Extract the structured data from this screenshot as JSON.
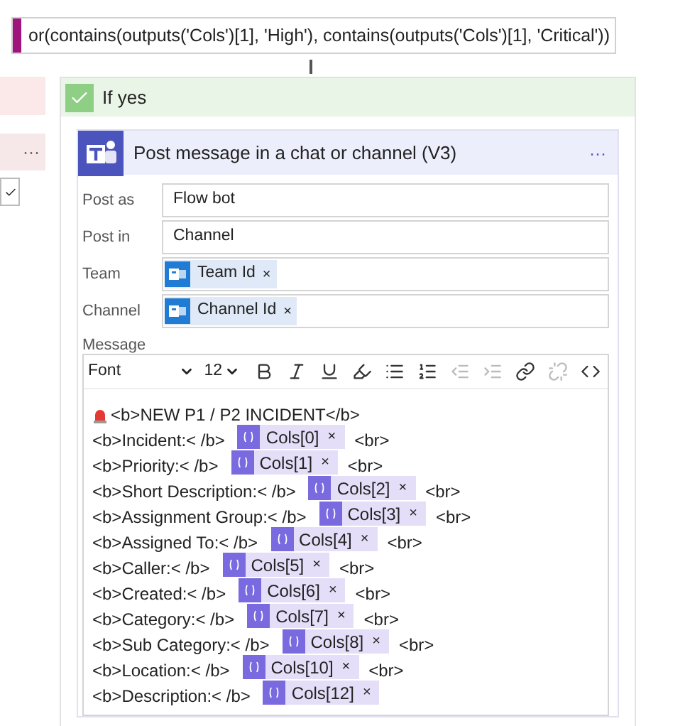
{
  "condition": {
    "expression": "or(contains(outputs('Cols')[1], 'High'), contains(outputs('Cols')[1], 'Critical'))"
  },
  "left_branch": {
    "more": "···"
  },
  "branch": {
    "title": "If yes",
    "checked": true
  },
  "action": {
    "title": "Post message in a chat or channel (V3)",
    "more": "···",
    "fields": [
      {
        "label": "Post as",
        "kind": "text",
        "value": "Flow bot"
      },
      {
        "label": "Post in",
        "kind": "text",
        "value": "Channel"
      },
      {
        "label": "Team",
        "kind": "token",
        "value": "Team Id",
        "remove": "×"
      },
      {
        "label": "Channel",
        "kind": "token",
        "value": "Channel Id",
        "remove": "×"
      }
    ],
    "message": {
      "label": "Message",
      "font": "Font",
      "size": "12",
      "lines": [
        {
          "kind": "heading",
          "text": "<b>NEW P1 / P2 INCIDENT</b>"
        },
        {
          "kind": "field",
          "text": "<b>Incident:< /b>",
          "token": "Cols[0]",
          "remove": "×",
          "end": "<br>"
        },
        {
          "kind": "field",
          "text": "<b>Priority:< /b>",
          "token": "Cols[1]",
          "remove": "×",
          "end": "<br>"
        },
        {
          "kind": "field",
          "text": "<b>Short Description:< /b>",
          "token": "Cols[2]",
          "remove": "×",
          "end": "<br>"
        },
        {
          "kind": "field",
          "text": "<b>Assignment Group:< /b>",
          "token": "Cols[3]",
          "remove": "×",
          "end": "<br>"
        },
        {
          "kind": "field",
          "text": "<b>Assigned To:< /b>",
          "token": "Cols[4]",
          "remove": "×",
          "end": "<br>"
        },
        {
          "kind": "field",
          "text": "<b>Caller:< /b>",
          "token": "Cols[5]",
          "remove": "×",
          "end": "<br>"
        },
        {
          "kind": "field",
          "text": "<b>Created:< /b>",
          "token": "Cols[6]",
          "remove": "×",
          "end": "<br>"
        },
        {
          "kind": "field",
          "text": "<b>Category:< /b>",
          "token": "Cols[7]",
          "remove": "×",
          "end": "<br>"
        },
        {
          "kind": "field",
          "text": "<b>Sub Category:< /b>",
          "token": "Cols[8]",
          "remove": "×",
          "end": "<br>"
        },
        {
          "kind": "field",
          "text": "<b>Location:< /b>",
          "token": "Cols[10]",
          "remove": "×",
          "end": "<br>"
        },
        {
          "kind": "field",
          "text": "<b>Description:< /b>",
          "token": "Cols[12]",
          "remove": "×"
        }
      ]
    }
  }
}
